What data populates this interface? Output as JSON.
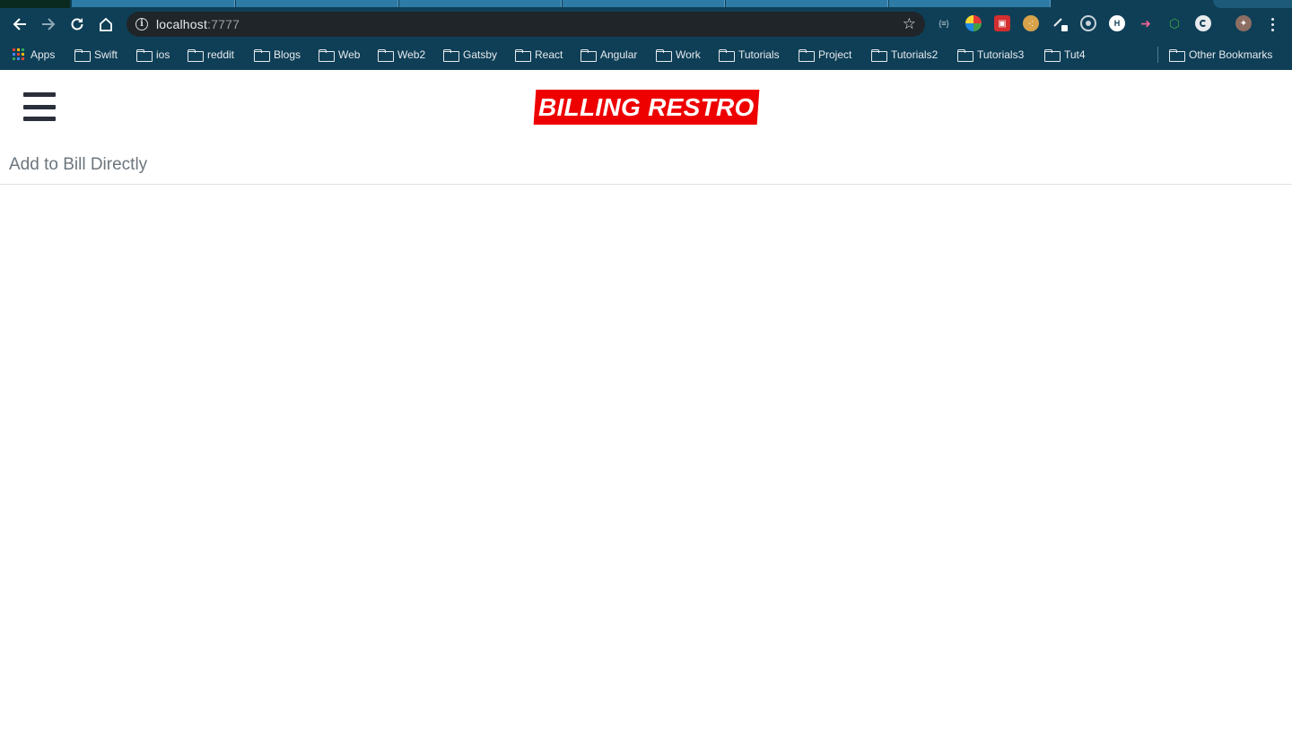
{
  "browser": {
    "address_bar": {
      "host": "localhost",
      "port": ":7777"
    },
    "extensions": [
      "json-formatter-icon",
      "color-picker-icon",
      "mobile-simulator-icon",
      "cookie-icon",
      "pen-tool-icon",
      "target-icon",
      "h-badge-icon",
      "arrow-extension-icon",
      "nodejs-icon",
      "refresh-circle-icon",
      "puzzle-avatar-icon"
    ],
    "bookmarks": [
      "Swift",
      "ios",
      "reddit",
      "Blogs",
      "Web",
      "Web2",
      "Gatsby",
      "React",
      "Angular",
      "Work",
      "Tutorials",
      "Project",
      "Tutorials2",
      "Tutorials3",
      "Tut4"
    ],
    "apps_label": "Apps",
    "other_bookmarks": "Other Bookmarks"
  },
  "app": {
    "logo_text": "BILLING RESTRO",
    "section_title": "Add to Bill Directly"
  },
  "colors": {
    "chrome": "#0e3f57",
    "omnibox": "#202529",
    "logo_bg": "#ee0000",
    "hamburger": "#2b2f3a",
    "section_title": "#6c757d",
    "divider": "#dee2e6"
  }
}
